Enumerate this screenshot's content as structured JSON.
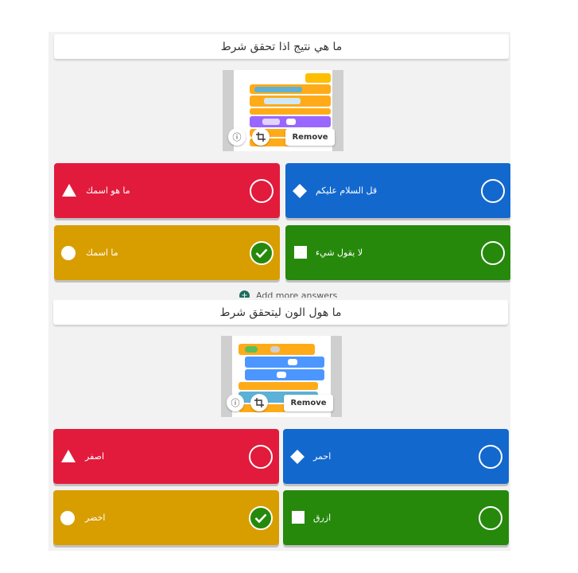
{
  "questions": [
    {
      "title": "ما هي نتيج  اذا تحقق شرط",
      "media": {
        "remove_label": "Remove",
        "info_icon": "info-icon",
        "crop_icon": "crop-icon"
      },
      "answers": [
        {
          "text": "ما  هو اسمك",
          "color": "#e21b3c",
          "shape": "triangle",
          "correct": false
        },
        {
          "text": "قل السلام عليكم",
          "color": "#1368ce",
          "shape": "diamond",
          "correct": false
        },
        {
          "text": "ما اسمك",
          "color": "#d89e00",
          "shape": "circle",
          "correct": true
        },
        {
          "text": "لا يقول شيء",
          "color": "#26890c",
          "shape": "square",
          "correct": false
        }
      ],
      "add_more_label": "Add more answers"
    },
    {
      "title": "ما هول الون ليتحقق شرط",
      "media": {
        "remove_label": "Remove",
        "info_icon": "info-icon",
        "crop_icon": "crop-icon"
      },
      "answers": [
        {
          "text": "اصفر",
          "color": "#e21b3c",
          "shape": "triangle",
          "correct": false
        },
        {
          "text": "احمر",
          "color": "#1368ce",
          "shape": "diamond",
          "correct": false
        },
        {
          "text": "اخضر",
          "color": "#d89e00",
          "shape": "circle",
          "correct": true
        },
        {
          "text": "ازرق",
          "color": "#26890c",
          "shape": "square",
          "correct": false
        }
      ]
    }
  ]
}
